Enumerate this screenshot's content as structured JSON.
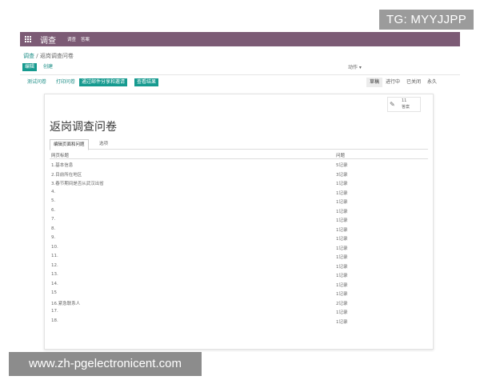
{
  "watermark_top": "TG: MYYJJPP",
  "watermark_bottom": "www.zh-pgelectronicent.com",
  "nav": {
    "brand": "调查",
    "menu": [
      "调查",
      "答案"
    ]
  },
  "breadcrumb": {
    "parent": "调查",
    "sep": "/",
    "current": "返岗调查问卷"
  },
  "control": {
    "edit": "编辑",
    "create": "创建",
    "actions": "动作 ▾"
  },
  "toolbar": {
    "test": "测试问卷",
    "print": "打印问卷",
    "share": "通过邮件分享和邀请",
    "results": "查看结果"
  },
  "status": [
    "草稿",
    "进行中",
    "已关闭",
    "永久"
  ],
  "stat": {
    "count": "11",
    "label": "答案"
  },
  "title": "返岗调查问卷",
  "tabs": [
    "编辑页面和问题",
    "选项"
  ],
  "table": {
    "headers": [
      "网页标题",
      "问题"
    ],
    "rows": [
      {
        "title": "1.基本信息",
        "q": "5记录"
      },
      {
        "title": "2.目前所在地区",
        "q": "3记录"
      },
      {
        "title": "3.春节期间是否从武汉出省",
        "q": "1记录"
      },
      {
        "title": "4.",
        "q": "1记录"
      },
      {
        "title": "5.",
        "q": "1记录"
      },
      {
        "title": "6.",
        "q": "1记录"
      },
      {
        "title": "7.",
        "q": "1记录"
      },
      {
        "title": "8.",
        "q": "1记录"
      },
      {
        "title": "9.",
        "q": "1记录"
      },
      {
        "title": "10.",
        "q": "1记录"
      },
      {
        "title": "11.",
        "q": "1记录"
      },
      {
        "title": "12.",
        "q": "1记录"
      },
      {
        "title": "13.",
        "q": "1记录"
      },
      {
        "title": "14.",
        "q": "1记录"
      },
      {
        "title": "15",
        "q": "1记录"
      },
      {
        "title": "16.紧急联系人",
        "q": "2记录"
      },
      {
        "title": "17.",
        "q": "1记录"
      },
      {
        "title": "18.",
        "q": "1记录"
      }
    ]
  }
}
